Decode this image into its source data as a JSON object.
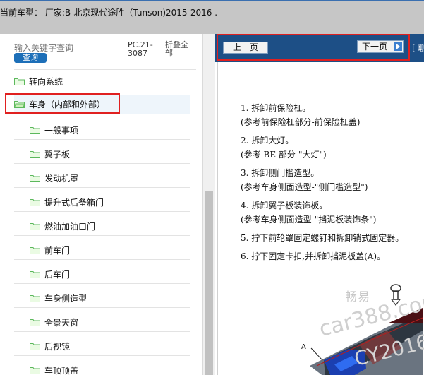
{
  "header": {
    "title": "当前车型：  厂家:B-北京现代途胜（Tunson)2015-2016   ."
  },
  "search": {
    "placeholder": "输入关键字查询",
    "button_label": "查询",
    "pc_code": "PC.21-3087",
    "collapse_all_label": "折叠全部"
  },
  "tree": {
    "items": [
      {
        "label": "转向系统"
      },
      {
        "label": "车身（内部和外部）"
      }
    ],
    "children": [
      {
        "label": "一般事项"
      },
      {
        "label": "翼子板"
      },
      {
        "label": "发动机罩"
      },
      {
        "label": "提升式后备箱门"
      },
      {
        "label": "燃油加油口门"
      },
      {
        "label": "前车门"
      },
      {
        "label": "后车门"
      },
      {
        "label": "车身侧造型"
      },
      {
        "label": "全景天窗"
      },
      {
        "label": "后视镜"
      },
      {
        "label": "车顶顶盖"
      }
    ]
  },
  "doc_nav": {
    "prev_label": "上一页",
    "next_label": "下一页",
    "side_label": "[ 聊"
  },
  "steps": [
    {
      "text": "1. 拆卸前保险杠。",
      "sub": "(参考前保险杠部分-前保险杠盖)"
    },
    {
      "text": "2. 拆卸大灯。",
      "sub": "(参考 BE 部分-\"大灯\")"
    },
    {
      "text": "3. 拆卸侧门槛造型。",
      "sub": "(参考车身侧面造型-\"侧门槛造型\")"
    },
    {
      "text": "4. 拆卸翼子板装饰板。",
      "sub": "(参考车身侧面造型-\"挡泥板装饰条\")"
    },
    {
      "text": "5. 拧下前轮罩固定螺钉和拆卸销式固定器。",
      "sub": ""
    },
    {
      "text": "6. 拧下固定卡扣,并拆卸挡泥板盖(A)。",
      "sub": ""
    }
  ],
  "figure": {
    "callout": "A"
  },
  "watermark": {
    "line1": "畅易",
    "line2": "car388.com",
    "line3": "CY2016"
  },
  "colors": {
    "header_bg": "#c6c6c6",
    "nav_strip": "#1d4f86",
    "accent_blue": "#1d6fb8",
    "highlight_red": "#e02020",
    "folder_green": "#5cb85c"
  }
}
